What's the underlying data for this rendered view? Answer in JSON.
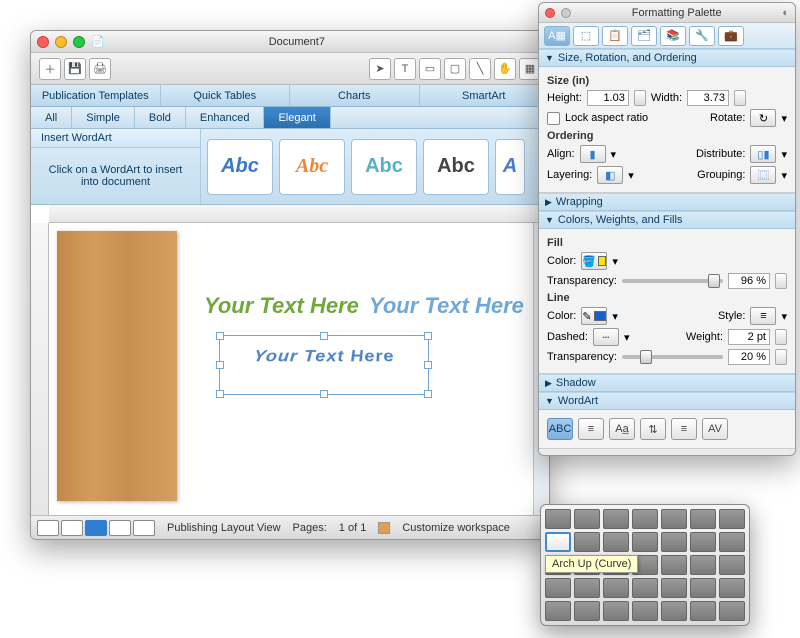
{
  "doc": {
    "title": "Document7",
    "tabs": [
      "Publication Templates",
      "Quick Tables",
      "Charts",
      "SmartArt"
    ],
    "styles": [
      "All",
      "Simple",
      "Bold",
      "Enhanced",
      "Elegant"
    ],
    "active_style": "Elegant",
    "wordart_title": "Insert WordArt",
    "wordart_hint": "Click on a WordArt to insert into document",
    "sample_text": "Abc",
    "canvas_text": "Your Text Here",
    "status_view": "Publishing Layout View",
    "status_pages_label": "Pages:",
    "status_pages_value": "1 of 1",
    "status_custom": "Customize workspace"
  },
  "palette": {
    "title": "Formatting Palette",
    "sec_size": "Size, Rotation, and Ordering",
    "size_label": "Size (in)",
    "height_label": "Height:",
    "height_value": "1.03",
    "width_label": "Width:",
    "width_value": "3.73",
    "lock_label": "Lock aspect ratio",
    "rotate_label": "Rotate:",
    "ordering_label": "Ordering",
    "align_label": "Align:",
    "distribute_label": "Distribute:",
    "layering_label": "Layering:",
    "grouping_label": "Grouping:",
    "sec_wrap": "Wrapping",
    "sec_colors": "Colors, Weights, and Fills",
    "fill_label": "Fill",
    "color_label": "Color:",
    "transparency_label": "Transparency:",
    "fill_transparency": "96 %",
    "line_label": "Line",
    "style_label": "Style:",
    "dashed_label": "Dashed:",
    "weight_label": "Weight:",
    "weight_value": "2 pt",
    "line_transparency": "20 %",
    "sec_shadow": "Shadow",
    "sec_wordart": "WordArt",
    "tooltip": "Arch Up (Curve)"
  }
}
